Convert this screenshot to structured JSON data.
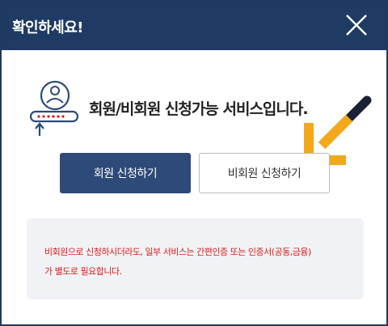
{
  "dialog": {
    "title": "확인하세요!",
    "close_label": "Close",
    "headline": "회원/비회원 신청가능 서비스입니다.",
    "illustration_icon": "member-login-icon",
    "buttons": {
      "member": "회원 신청하기",
      "guest": "비회원 신청하기"
    },
    "notice": {
      "line1": "비회원으로 신청하시더라도, 일부 서비스는 간편인증 또는 인증서(공동,금융)",
      "line2": "가 별도로 필요합니다."
    }
  },
  "colors": {
    "header_bg": "#1f3b63",
    "primary_button": "#2d4a78",
    "notice_text": "#d81b1b",
    "arrow": "#f3a81b"
  }
}
